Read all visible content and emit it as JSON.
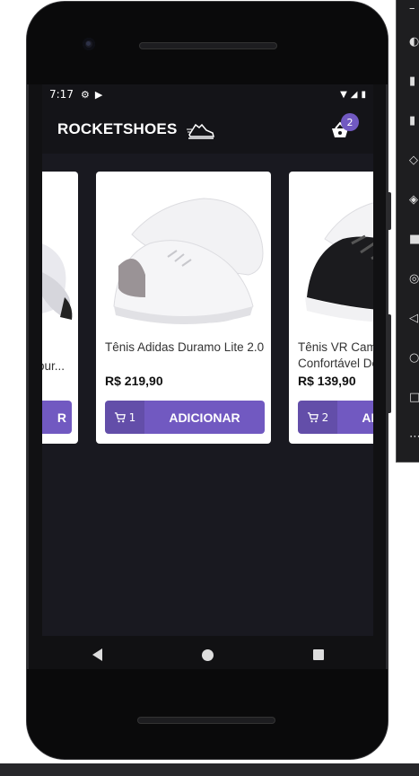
{
  "status_bar": {
    "time": "7:17"
  },
  "app": {
    "brand": "ROCKETSHOES",
    "cart_count": "2"
  },
  "products": [
    {
      "title": "our...",
      "price": "",
      "qty": "",
      "button_label": "R"
    },
    {
      "title": "Tênis Adidas Duramo Lite 2.0",
      "price": "R$ 219,90",
      "qty": "1",
      "button_label": "ADICIONAR"
    },
    {
      "title": "Tênis VR Caminhada Confortável Detalhes",
      "price": "R$ 139,90",
      "qty": "2",
      "button_label": "ADICIONAR"
    }
  ],
  "colors": {
    "accent": "#7159c1",
    "background": "#191920"
  },
  "icons": [
    "settings-icon",
    "play-store-icon",
    "wifi-icon",
    "signal-icon",
    "battery-icon",
    "running-shoe-icon",
    "shopping-basket-icon",
    "add-shopping-cart-icon",
    "back-icon",
    "home-icon",
    "recents-icon"
  ]
}
